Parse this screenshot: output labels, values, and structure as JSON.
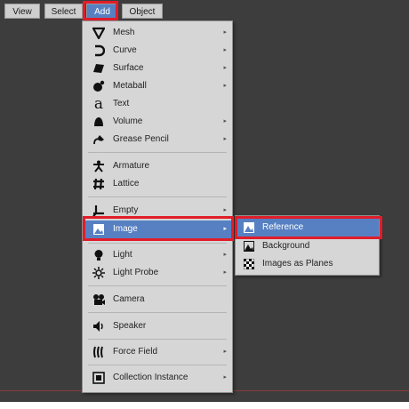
{
  "topbar": {
    "view": "View",
    "select": "Select",
    "add": "Add",
    "object": "Object"
  },
  "add_menu": {
    "items": [
      {
        "label": "Mesh",
        "icon": "mesh-icon",
        "submenu": true
      },
      {
        "label": "Curve",
        "icon": "curve-icon",
        "submenu": true
      },
      {
        "label": "Surface",
        "icon": "surface-icon",
        "submenu": true
      },
      {
        "label": "Metaball",
        "icon": "metaball-icon",
        "submenu": true
      },
      {
        "label": "Text",
        "icon": "text-icon",
        "submenu": false
      },
      {
        "label": "Volume",
        "icon": "volume-icon",
        "submenu": true
      },
      {
        "label": "Grease Pencil",
        "icon": "grease-pencil-icon",
        "submenu": true
      },
      {
        "label": "Armature",
        "icon": "armature-icon",
        "submenu": false
      },
      {
        "label": "Lattice",
        "icon": "lattice-icon",
        "submenu": false
      },
      {
        "label": "Empty",
        "icon": "empty-icon",
        "submenu": true
      },
      {
        "label": "Image",
        "icon": "image-icon",
        "submenu": true,
        "active": true
      },
      {
        "label": "Light",
        "icon": "light-icon",
        "submenu": true
      },
      {
        "label": "Light Probe",
        "icon": "light-probe-icon",
        "submenu": true
      },
      {
        "label": "Camera",
        "icon": "camera-icon",
        "submenu": false
      },
      {
        "label": "Speaker",
        "icon": "speaker-icon",
        "submenu": false
      },
      {
        "label": "Force Field",
        "icon": "force-field-icon",
        "submenu": true
      },
      {
        "label": "Collection Instance",
        "icon": "collection-instance-icon",
        "submenu": true
      }
    ]
  },
  "image_submenu": {
    "items": [
      {
        "label": "Reference",
        "icon": "reference-icon",
        "active": true
      },
      {
        "label": "Background",
        "icon": "background-icon"
      },
      {
        "label": "Images as Planes",
        "icon": "images-as-planes-icon"
      }
    ]
  },
  "colors": {
    "highlight_outline": "#e11d2a",
    "active_item": "#5680c2",
    "menu_bg": "#d6d6d6",
    "viewport_bg": "#3d3d3d"
  }
}
